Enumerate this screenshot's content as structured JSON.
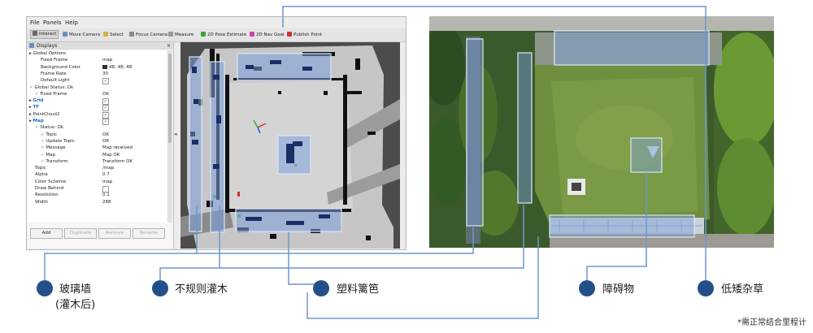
{
  "rviz": {
    "menu": [
      "File",
      "Panels",
      "Help"
    ],
    "toolbar": [
      {
        "label": "Interact",
        "icon": "cursor-icon",
        "color": "#666666",
        "active": true
      },
      {
        "label": "Move Camera",
        "icon": "move-camera-icon",
        "color": "#6b8fbf"
      },
      {
        "label": "Select",
        "icon": "select-icon",
        "color": "#d8b04a"
      },
      {
        "label": "Focus Camera",
        "icon": "focus-camera-icon",
        "color": "#888888"
      },
      {
        "label": "Measure",
        "icon": "measure-icon",
        "color": "#999999"
      },
      {
        "label": "2D Pose Estimate",
        "icon": "green-arrow-icon",
        "color": "#3aa03a"
      },
      {
        "label": "2D Nav Goal",
        "icon": "pink-arrow-icon",
        "color": "#d040b0"
      },
      {
        "label": "Publish Point",
        "icon": "red-pin-icon",
        "color": "#d03030"
      }
    ],
    "panel_title": "Displays",
    "tree": [
      {
        "indent": 0,
        "label": "Global Options",
        "value": "",
        "kind": "group"
      },
      {
        "indent": 2,
        "label": "Fixed Frame",
        "value": "map"
      },
      {
        "indent": 2,
        "label": "Background Color",
        "value": "48; 48; 48",
        "swatch": "#303030"
      },
      {
        "indent": 2,
        "label": "Frame Rate",
        "value": "30"
      },
      {
        "indent": 2,
        "label": "Default Light",
        "value": "✓",
        "box": true
      },
      {
        "indent": 0,
        "label": "Global Status: Ok",
        "value": "",
        "check": true
      },
      {
        "indent": 1,
        "label": "Fixed Frame",
        "value": "OK",
        "check": true
      },
      {
        "indent": 0,
        "label": "Grid",
        "value": "✓",
        "blue": true,
        "box": true
      },
      {
        "indent": 0,
        "label": "TF",
        "value": "✓",
        "blue": true,
        "box": true
      },
      {
        "indent": 0,
        "label": "PointCloud2",
        "value": "✓",
        "box": true
      },
      {
        "indent": 0,
        "label": "Map",
        "value": "✓",
        "blue": true,
        "box": true
      },
      {
        "indent": 1,
        "label": "Status: Ok",
        "value": "",
        "check": true
      },
      {
        "indent": 2,
        "label": "Topic",
        "value": "OK",
        "check": true
      },
      {
        "indent": 2,
        "label": "Update Topic",
        "value": "OK",
        "check": true
      },
      {
        "indent": 2,
        "label": "Message",
        "value": "Map received",
        "check": true
      },
      {
        "indent": 2,
        "label": "Map",
        "value": "Map OK",
        "check": true
      },
      {
        "indent": 2,
        "label": "Transform",
        "value": "Transform OK",
        "check": true
      },
      {
        "indent": 1,
        "label": "Topic",
        "value": "/map"
      },
      {
        "indent": 1,
        "label": "Alpha",
        "value": "0.7"
      },
      {
        "indent": 1,
        "label": "Color Scheme",
        "value": "map"
      },
      {
        "indent": 1,
        "label": "Draw Behind",
        "value": "",
        "box": true
      },
      {
        "indent": 1,
        "label": "Resolution",
        "value": "0.1"
      },
      {
        "indent": 1,
        "label": "Width",
        "value": "288"
      }
    ],
    "buttons": [
      "Add",
      "Duplicate",
      "Remove",
      "Rename"
    ]
  },
  "callouts": [
    {
      "id": "glass-wall",
      "line1": "玻璃墙",
      "line2": "(灌木后)"
    },
    {
      "id": "irregular-shrub",
      "line1": "不规则灌木"
    },
    {
      "id": "plastic-fence",
      "line1": "塑料篱笆"
    },
    {
      "id": "obstacle",
      "line1": "障碍物"
    },
    {
      "id": "low-weeds",
      "line1": "低矮杂草"
    }
  ],
  "footnote": "*需正常结合里程计",
  "colors": {
    "accent": "#24508a",
    "connector": "#6e97cc",
    "highlight": "#7da0dc"
  }
}
